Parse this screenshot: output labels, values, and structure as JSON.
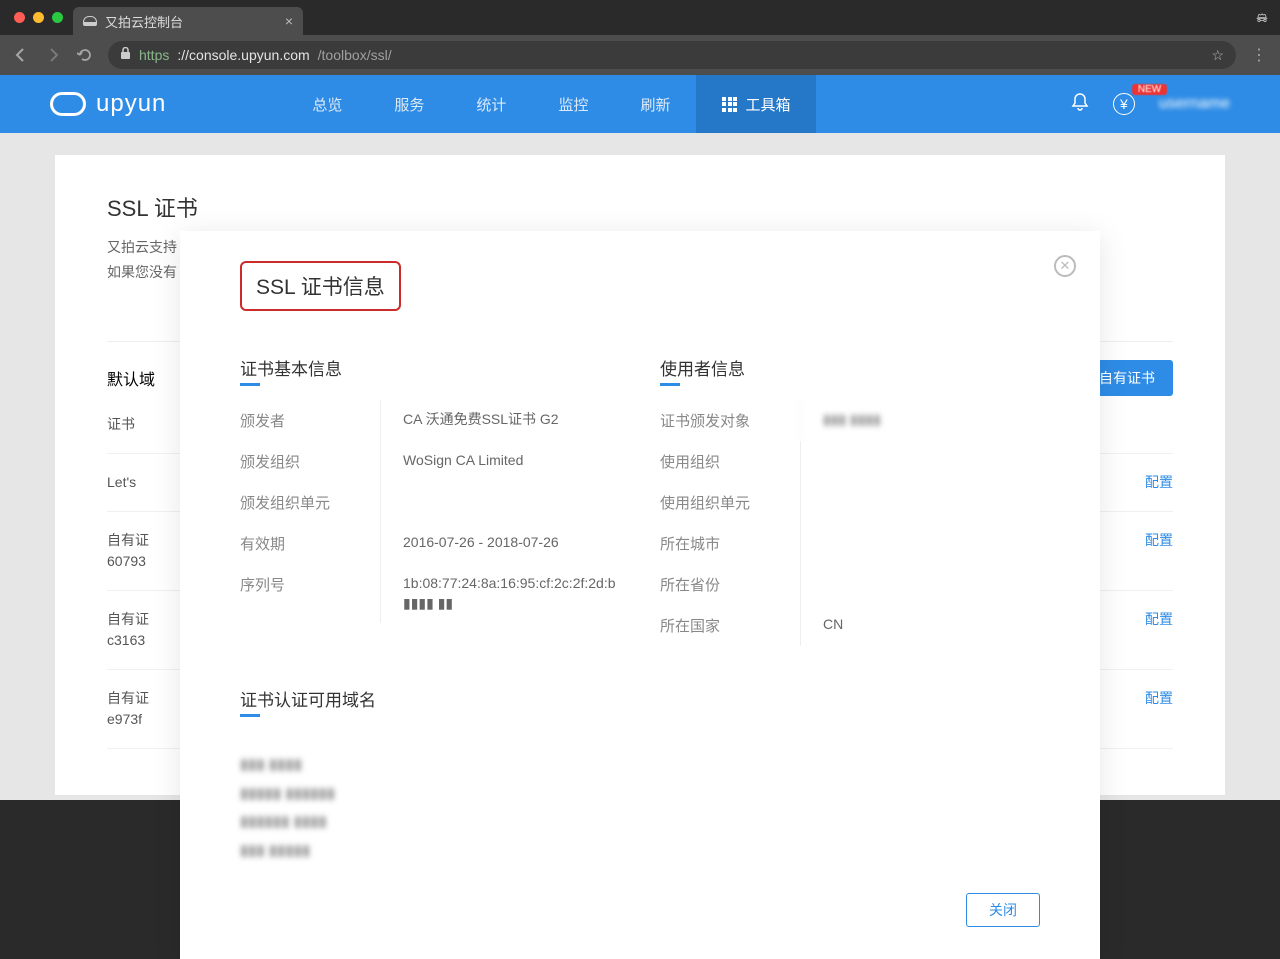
{
  "browser": {
    "tab_title": "又拍云控制台",
    "url_proto": "https",
    "url_host": "://console.upyun.com",
    "url_path": "/toolbox/ssl/"
  },
  "topnav": {
    "brand": "upyun",
    "items": [
      "总览",
      "服务",
      "统计",
      "监控",
      "刷新",
      "工具箱"
    ],
    "badge": "NEW",
    "user": "username"
  },
  "page": {
    "title": "SSL 证书",
    "desc1": "又拍云支持",
    "desc2": "如果您没有",
    "default_label": "默认域",
    "upload_btn": "自有证书",
    "cert_col": "证书",
    "config": "配置",
    "certs": [
      {
        "l1": "Let's ",
        "l2": ""
      },
      {
        "l1": "自有证",
        "l2": "60793"
      },
      {
        "l1": "自有证",
        "l2": "c3163"
      },
      {
        "l1": "自有证",
        "l2": "e973f"
      }
    ]
  },
  "modal": {
    "title": "SSL 证书信息",
    "close_btn": "关闭",
    "basic": {
      "heading": "证书基本信息",
      "issuer_k": "颁发者",
      "issuer_v": "CA 沃通免费SSL证书 G2",
      "org_k": "颁发组织",
      "org_v": "WoSign CA Limited",
      "unit_k": "颁发组织单元",
      "unit_v": "",
      "valid_k": "有效期",
      "valid_v": "2016-07-26 - 2018-07-26",
      "serial_k": "序列号",
      "serial_v": "1b:08:77:24:8a:16:95:cf:2c:2f:2d:b ▮▮▮▮ ▮▮"
    },
    "user": {
      "heading": "使用者信息",
      "subject_k": "证书颁发对象",
      "subject_v": "▮▮▮  ▮▮▮▮",
      "org_k": "使用组织",
      "unit_k": "使用组织单元",
      "city_k": "所在城市",
      "prov_k": "所在省份",
      "country_k": "所在国家",
      "country_v": "CN"
    },
    "domains": {
      "heading": "证书认证可用域名",
      "list": [
        "▮▮▮ ▮▮▮▮",
        "▮▮▮▮▮ ▮▮▮▮▮▮",
        "▮▮▮▮▮▮ ▮▮▮▮",
        "▮▮▮ ▮▮▮▮▮"
      ]
    }
  }
}
